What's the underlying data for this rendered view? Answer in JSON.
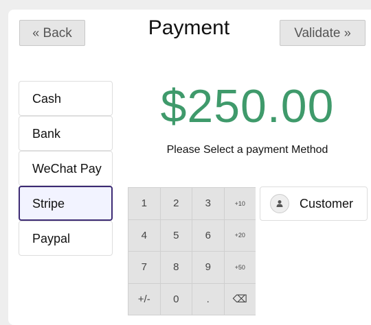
{
  "header": {
    "back_label": "Back",
    "title": "Payment",
    "validate_label": "Validate"
  },
  "payment_methods": [
    {
      "label": "Cash",
      "selected": false
    },
    {
      "label": "Bank",
      "selected": false
    },
    {
      "label": "WeChat Pay",
      "selected": false
    },
    {
      "label": "Stripe",
      "selected": true
    },
    {
      "label": "Paypal",
      "selected": false
    }
  ],
  "amount": "$250.00",
  "hint": "Please Select a payment Method",
  "numpad": {
    "keys": [
      "1",
      "2",
      "3",
      "+10",
      "4",
      "5",
      "6",
      "+20",
      "7",
      "8",
      "9",
      "+50",
      "+/-",
      "0",
      ".",
      "⌫"
    ]
  },
  "customer": {
    "label": "Customer",
    "icon": "user-icon"
  },
  "colors": {
    "amount": "#3f9a6b",
    "selected_border": "#3c2a73",
    "selected_bg": "#f2f3ff"
  }
}
